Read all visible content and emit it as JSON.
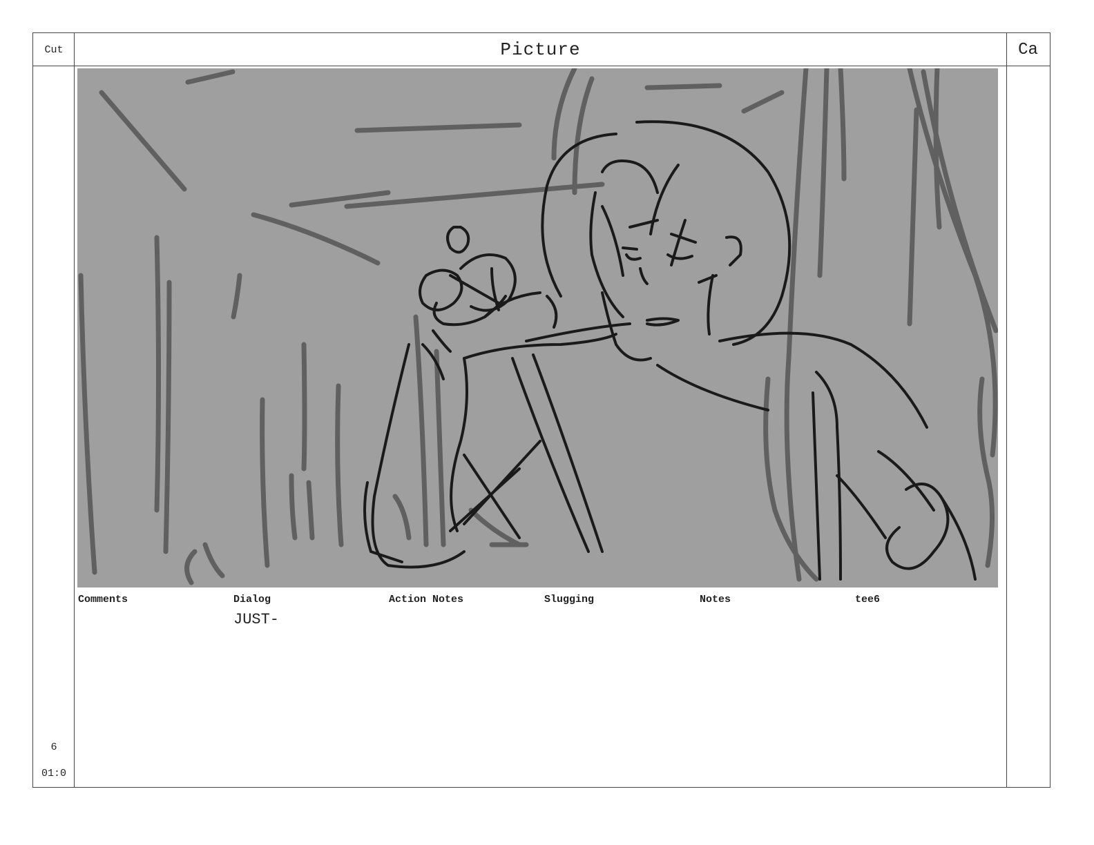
{
  "header": {
    "cut_label": "Cut",
    "picture_label": "Picture",
    "camera_label": "Ca"
  },
  "fields": [
    {
      "label": "Comments",
      "value": ""
    },
    {
      "label": "Dialog",
      "value": "JUST-"
    },
    {
      "label": "Action Notes",
      "value": ""
    },
    {
      "label": "Slugging",
      "value": ""
    },
    {
      "label": "Notes",
      "value": ""
    },
    {
      "label": "tee6",
      "value": ""
    }
  ],
  "cut": {
    "number": "6",
    "time": "01:0"
  },
  "panel": {
    "background_color": "#9f9f9f",
    "sketch_color": "#1a1a1a",
    "background_stroke_color": "#606060"
  }
}
